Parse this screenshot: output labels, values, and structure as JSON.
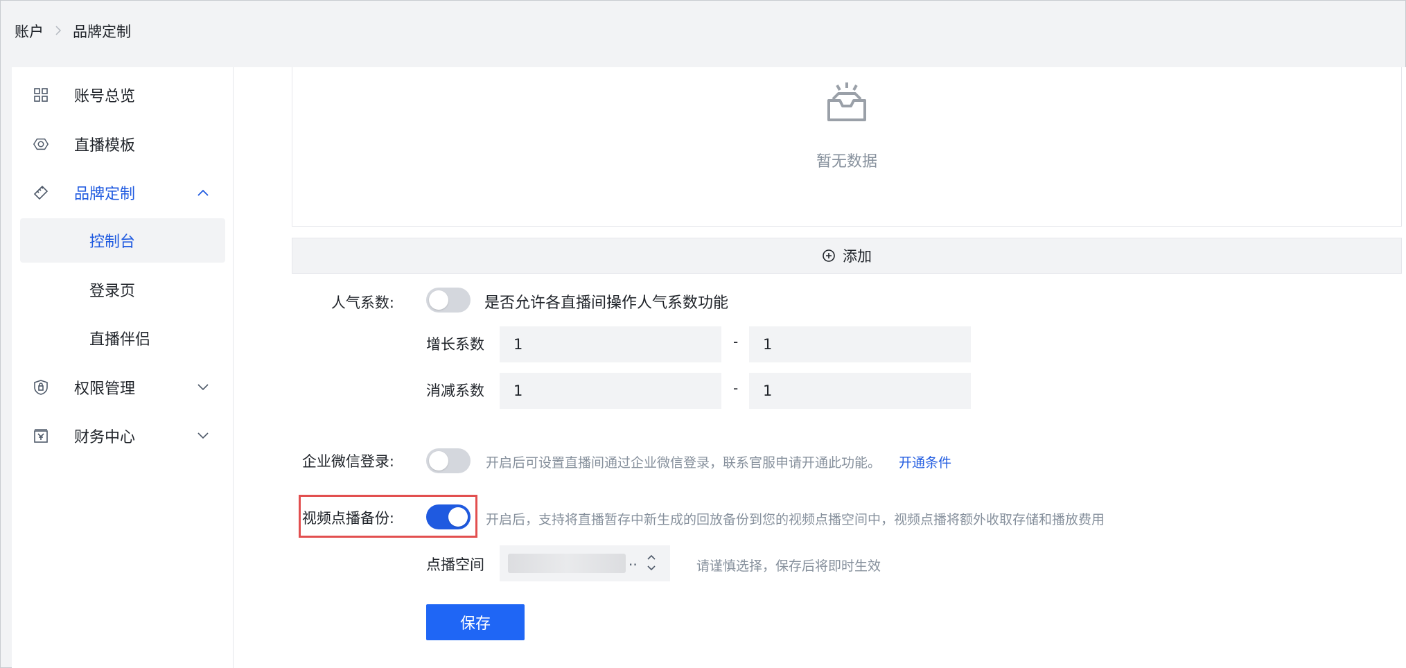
{
  "breadcrumb": {
    "root": "账户",
    "current": "品牌定制"
  },
  "sidebar": {
    "items": [
      {
        "label": "账号总览",
        "icon": "grid-icon"
      },
      {
        "label": "直播模板",
        "icon": "template-icon"
      },
      {
        "label": "品牌定制",
        "icon": "ruler-icon",
        "expanded": true,
        "active": true
      },
      {
        "label": "权限管理",
        "icon": "shield-icon"
      },
      {
        "label": "财务中心",
        "icon": "finance-icon"
      }
    ],
    "sub_items": [
      {
        "label": "控制台",
        "selected": true
      },
      {
        "label": "登录页"
      },
      {
        "label": "直播伴侣"
      }
    ]
  },
  "empty_state": {
    "text": "暂无数据",
    "icon": "empty-inbox-icon"
  },
  "add_button": {
    "label": "添加",
    "icon": "plus-circle-icon"
  },
  "popularity": {
    "label": "人气系数:",
    "toggle_on": false,
    "description": "是否允许各直播间操作人气系数功能",
    "growth_label": "增长系数",
    "growth_min": "1",
    "growth_max": "1",
    "decay_label": "消减系数",
    "decay_min": "1",
    "decay_max": "1",
    "dash": "-"
  },
  "wecom_login": {
    "label": "企业微信登录:",
    "toggle_on": false,
    "description": "开启后可设置直播间通过企业微信登录，联系官服申请开通此功能。",
    "link": "开通条件"
  },
  "vod_backup": {
    "label": "视频点播备份:",
    "toggle_on": true,
    "description": "开启后，支持将直播暂存中新生成的回放备份到您的视频点播空间中，视频点播将额外收取存储和播放费用",
    "space_label": "点播空间",
    "space_value_truncated": "..",
    "hint": "请谨慎选择，保存后将即时生效"
  },
  "save_button": {
    "label": "保存"
  },
  "colors": {
    "accent": "#1f5ae0",
    "button": "#1f66f5",
    "highlight": "#e24f4f",
    "muted": "#86909c"
  }
}
